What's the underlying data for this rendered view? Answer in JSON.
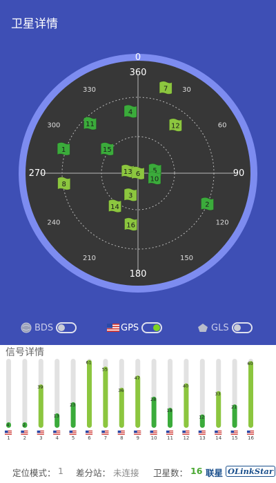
{
  "app": {
    "title": "卫星详情"
  },
  "radar": {
    "bearings": [
      "0",
      "30",
      "60",
      "90",
      "120",
      "150",
      "180",
      "210",
      "240",
      "270",
      "300",
      "330",
      "360"
    ],
    "colors": {
      "ring": "#7d8cf0",
      "dial": "#373737",
      "high": "#8cc63f",
      "low": "#3bab3b",
      "grid": "#ffffff"
    },
    "satellites": [
      {
        "id": "7",
        "az": 18,
        "el": 12,
        "shade": "high"
      },
      {
        "id": "12",
        "az": 38,
        "el": 37,
        "shade": "high"
      },
      {
        "id": "4",
        "az": 353,
        "el": 36,
        "shade": "low"
      },
      {
        "id": "11",
        "az": 316,
        "el": 30,
        "shade": "low"
      },
      {
        "id": "1",
        "az": 288,
        "el": 22,
        "shade": "low"
      },
      {
        "id": "15",
        "az": 308,
        "el": 56,
        "shade": "low"
      },
      {
        "id": "13",
        "az": 281,
        "el": 81,
        "shade": "high"
      },
      {
        "id": "6",
        "az": 90,
        "el": 90,
        "shade": "high"
      },
      {
        "id": "5",
        "az": 80,
        "el": 75,
        "shade": "low"
      },
      {
        "id": "10",
        "az": 107,
        "el": 75,
        "shade": "low"
      },
      {
        "id": "8",
        "az": 262,
        "el": 25,
        "shade": "high"
      },
      {
        "id": "3",
        "az": 199,
        "el": 70,
        "shade": "high"
      },
      {
        "id": "14",
        "az": 215,
        "el": 55,
        "shade": "high"
      },
      {
        "id": "2",
        "az": 114,
        "el": 24,
        "shade": "low"
      },
      {
        "id": "16",
        "az": 188,
        "el": 45,
        "shade": "high"
      }
    ]
  },
  "toggles": [
    {
      "label": "BDS",
      "icon": "globe-icon",
      "on": false
    },
    {
      "label": "GPS",
      "icon": "us-flag-icon",
      "on": true
    },
    {
      "label": "GLS",
      "icon": "pentagon-icon",
      "on": false
    }
  ],
  "signals": {
    "title": "信号详情",
    "items": [
      {
        "id": "1",
        "value": 4,
        "shade": "low"
      },
      {
        "id": "2",
        "value": 2,
        "shade": "low"
      },
      {
        "id": "3",
        "value": 39,
        "shade": "high"
      },
      {
        "id": "4",
        "value": 13,
        "shade": "low"
      },
      {
        "id": "5",
        "value": 23,
        "shade": "low"
      },
      {
        "id": "6",
        "value": 61,
        "shade": "high"
      },
      {
        "id": "7",
        "value": 55,
        "shade": "high"
      },
      {
        "id": "8",
        "value": 36,
        "shade": "high"
      },
      {
        "id": "9",
        "value": 47,
        "shade": "high"
      },
      {
        "id": "10",
        "value": 28,
        "shade": "low"
      },
      {
        "id": "11",
        "value": 18,
        "shade": "low"
      },
      {
        "id": "12",
        "value": 40,
        "shade": "high"
      },
      {
        "id": "13",
        "value": 12,
        "shade": "low"
      },
      {
        "id": "14",
        "value": 33,
        "shade": "high"
      },
      {
        "id": "15",
        "value": 21,
        "shade": "low"
      },
      {
        "id": "16",
        "value": 60,
        "shade": "high"
      }
    ]
  },
  "footer": {
    "mode_label": "定位模式：",
    "mode_value": "1",
    "diff_label": "差分站：",
    "diff_value": "未连接",
    "sat_label": "卫星数：",
    "sat_value": "16",
    "brand_cn": "联星",
    "brand_en": "OLinkStar"
  }
}
